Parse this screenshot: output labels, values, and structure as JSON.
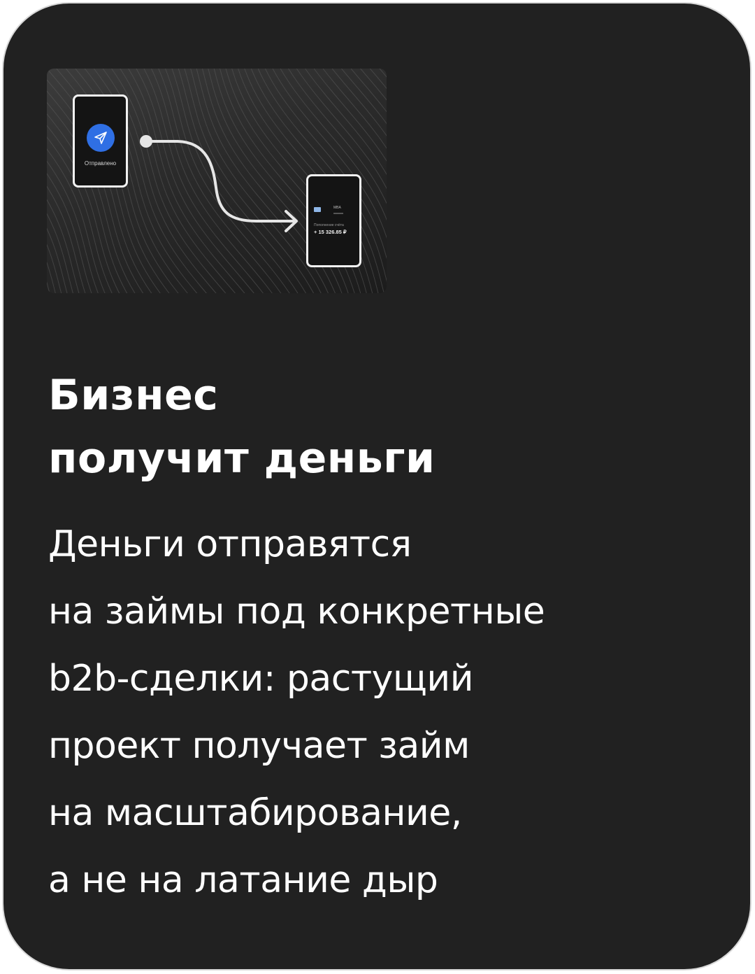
{
  "colors": {
    "card_background": "#212121",
    "card_border": "#d8d8d8",
    "text": "#ffffff",
    "send_icon_background": "#2f6fe4"
  },
  "illustration": {
    "sender_phone": {
      "icon": "paper-plane-icon",
      "status": "Отправлено"
    },
    "receiver_phone": {
      "bank_label": "MBA",
      "caption": "Пополнение счёта",
      "amount": "+ 15 326.85 ₽"
    },
    "connector_icon": "arrow-right-icon"
  },
  "heading": {
    "lines": [
      "Бизнес",
      "получит деньги"
    ]
  },
  "description": {
    "lines": [
      "Деньги отправятся",
      "на займы под конкретные",
      "b2b-сделки:  растущий",
      "проект получает займ",
      "на масштабирование,",
      "а не на латание дыр"
    ]
  }
}
